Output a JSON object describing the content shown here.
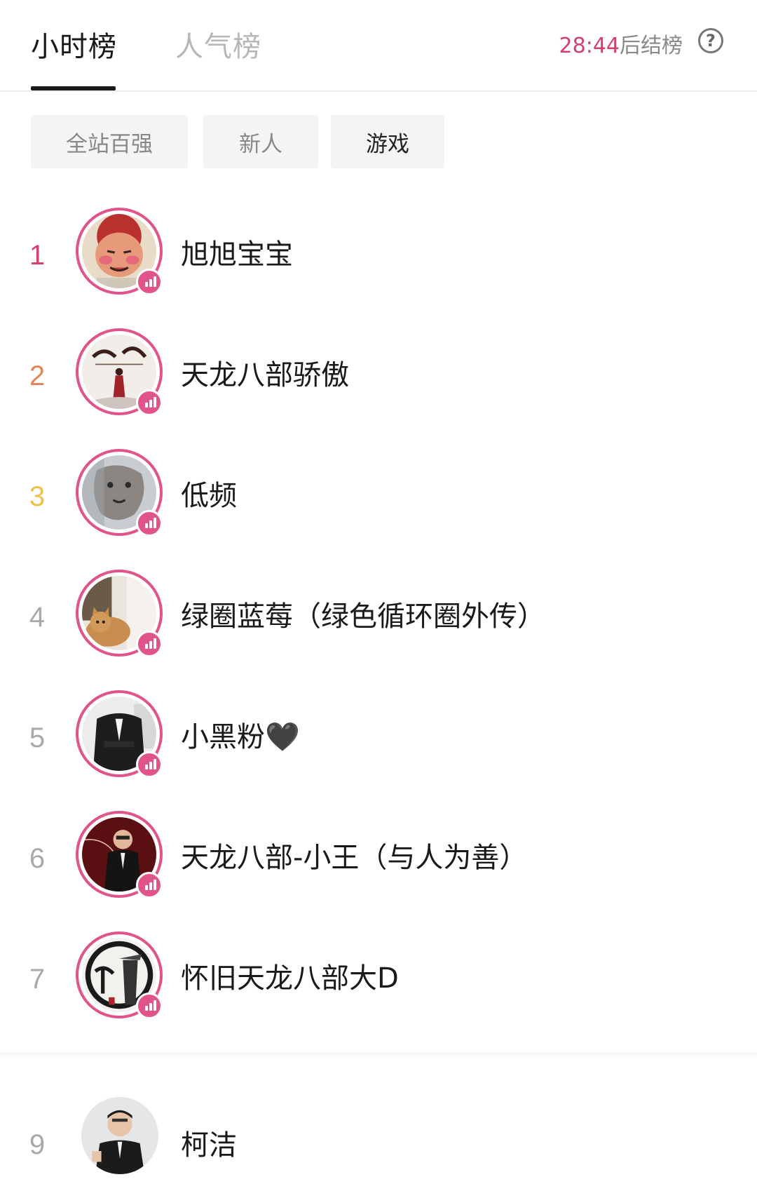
{
  "tabs": {
    "hourly": "小时榜",
    "popular": "人气榜"
  },
  "countdown": {
    "time": "28:44",
    "suffix": "后结榜"
  },
  "help_icon": "question-circle-icon",
  "chips": [
    "全站百强",
    "新人",
    "游戏"
  ],
  "active_chip": "游戏",
  "colors": {
    "accent": "#e0548a",
    "rank1": "#d3416c",
    "rank2": "#e0875a",
    "rank3": "#f0c04a",
    "rank_other": "#a9a9a9"
  },
  "rows": [
    {
      "rank": "1",
      "name": "旭旭宝宝",
      "live": true
    },
    {
      "rank": "2",
      "name": "天龙八部骄傲",
      "live": true
    },
    {
      "rank": "3",
      "name": "低频",
      "live": true
    },
    {
      "rank": "4",
      "name": "绿圈蓝莓（绿色循环圈外传）",
      "live": true
    },
    {
      "rank": "5",
      "name": "小黑粉🖤",
      "live": true
    },
    {
      "rank": "6",
      "name": "天龙八部-小王（与人为善）",
      "live": true
    },
    {
      "rank": "7",
      "name": "怀旧天龙八部大D",
      "live": true
    },
    {
      "rank": "9",
      "name": "柯洁",
      "live": false
    }
  ]
}
